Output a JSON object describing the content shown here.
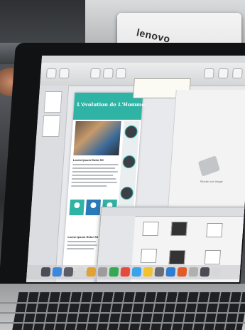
{
  "back_laptop": {
    "logo": "lenovo"
  },
  "screen": {
    "menubar_items": [
      "",
      "",
      "",
      "",
      "",
      "",
      ""
    ],
    "document": {
      "title": "L'évolution de L'Homme",
      "subtitle": "Lorem Ipsum Dolor Sit",
      "subtitle2": "Lorem Ipsum Dolor Sit"
    },
    "tooltip": {
      "text": ""
    },
    "placeholder": {
      "text": "Stocke une image"
    },
    "finder": {
      "sidebar_items": [
        "",
        "",
        "",
        "",
        "",
        "",
        "",
        ""
      ]
    }
  },
  "colors": {
    "accent": "#2fb3a4",
    "accent_blue": "#2a7ab8",
    "selection": "#3a7fd5"
  }
}
